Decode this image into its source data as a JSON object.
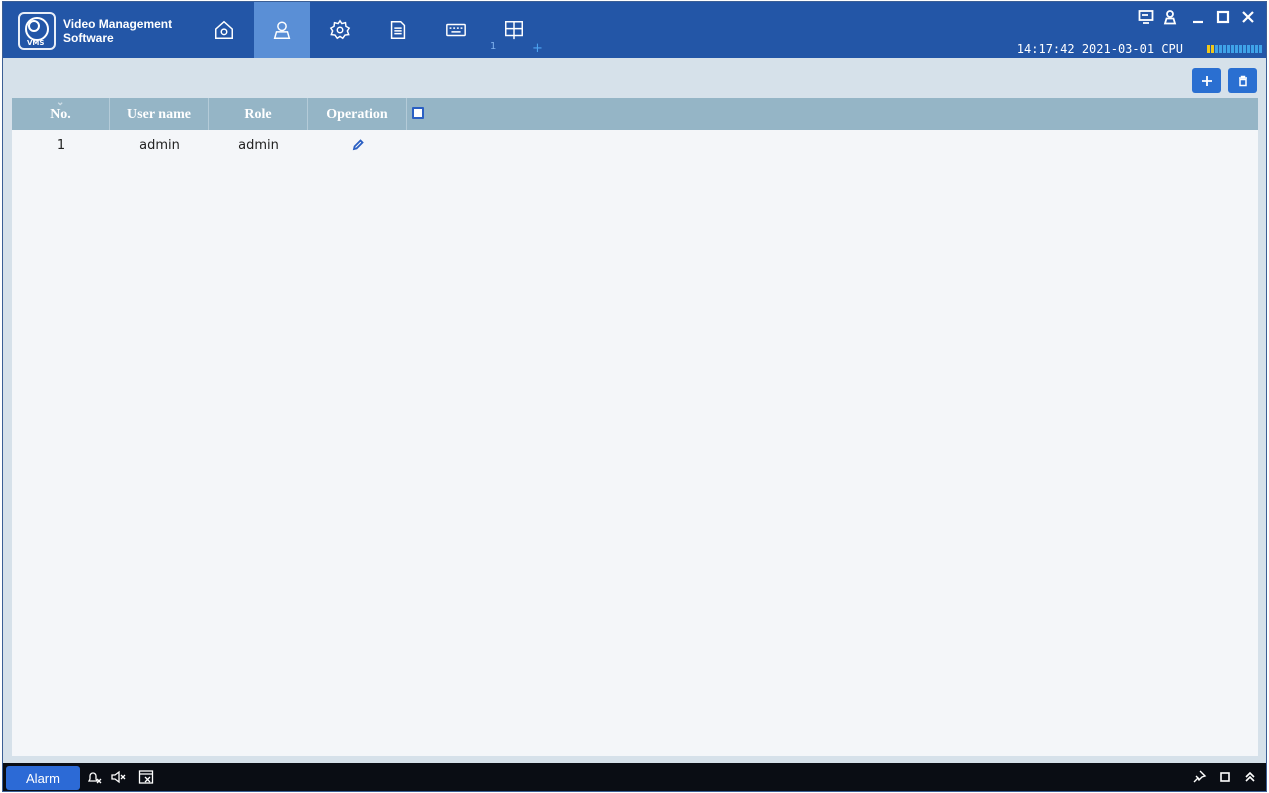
{
  "app": {
    "title_line1": "Video Management",
    "title_line2": "Software",
    "logo_tag": "VMS"
  },
  "nav": {
    "tabs": [
      {
        "name": "home",
        "icon": "home-icon"
      },
      {
        "name": "user",
        "icon": "user-icon",
        "active": true
      },
      {
        "name": "settings",
        "icon": "gear-icon"
      },
      {
        "name": "log",
        "icon": "document-icon"
      },
      {
        "name": "device",
        "icon": "keyboard-icon"
      },
      {
        "name": "view",
        "icon": "grid-window-icon",
        "badge": "1",
        "add": "+"
      }
    ]
  },
  "status": {
    "time": "14:17:42",
    "date": "2021-03-01",
    "cpu_label": "CPU",
    "cpu_level": 0.15
  },
  "table": {
    "headers": [
      "No.",
      "User name",
      "Role",
      "Operation"
    ],
    "rows": [
      {
        "no": "1",
        "user": "admin",
        "role": "admin"
      }
    ]
  },
  "bottom": {
    "alarm_label": "Alarm"
  },
  "colors": {
    "topbar": "#2356a7",
    "active_tab": "#5a8fd6",
    "table_header": "#95b5c6",
    "accent": "#2a6fd1"
  }
}
